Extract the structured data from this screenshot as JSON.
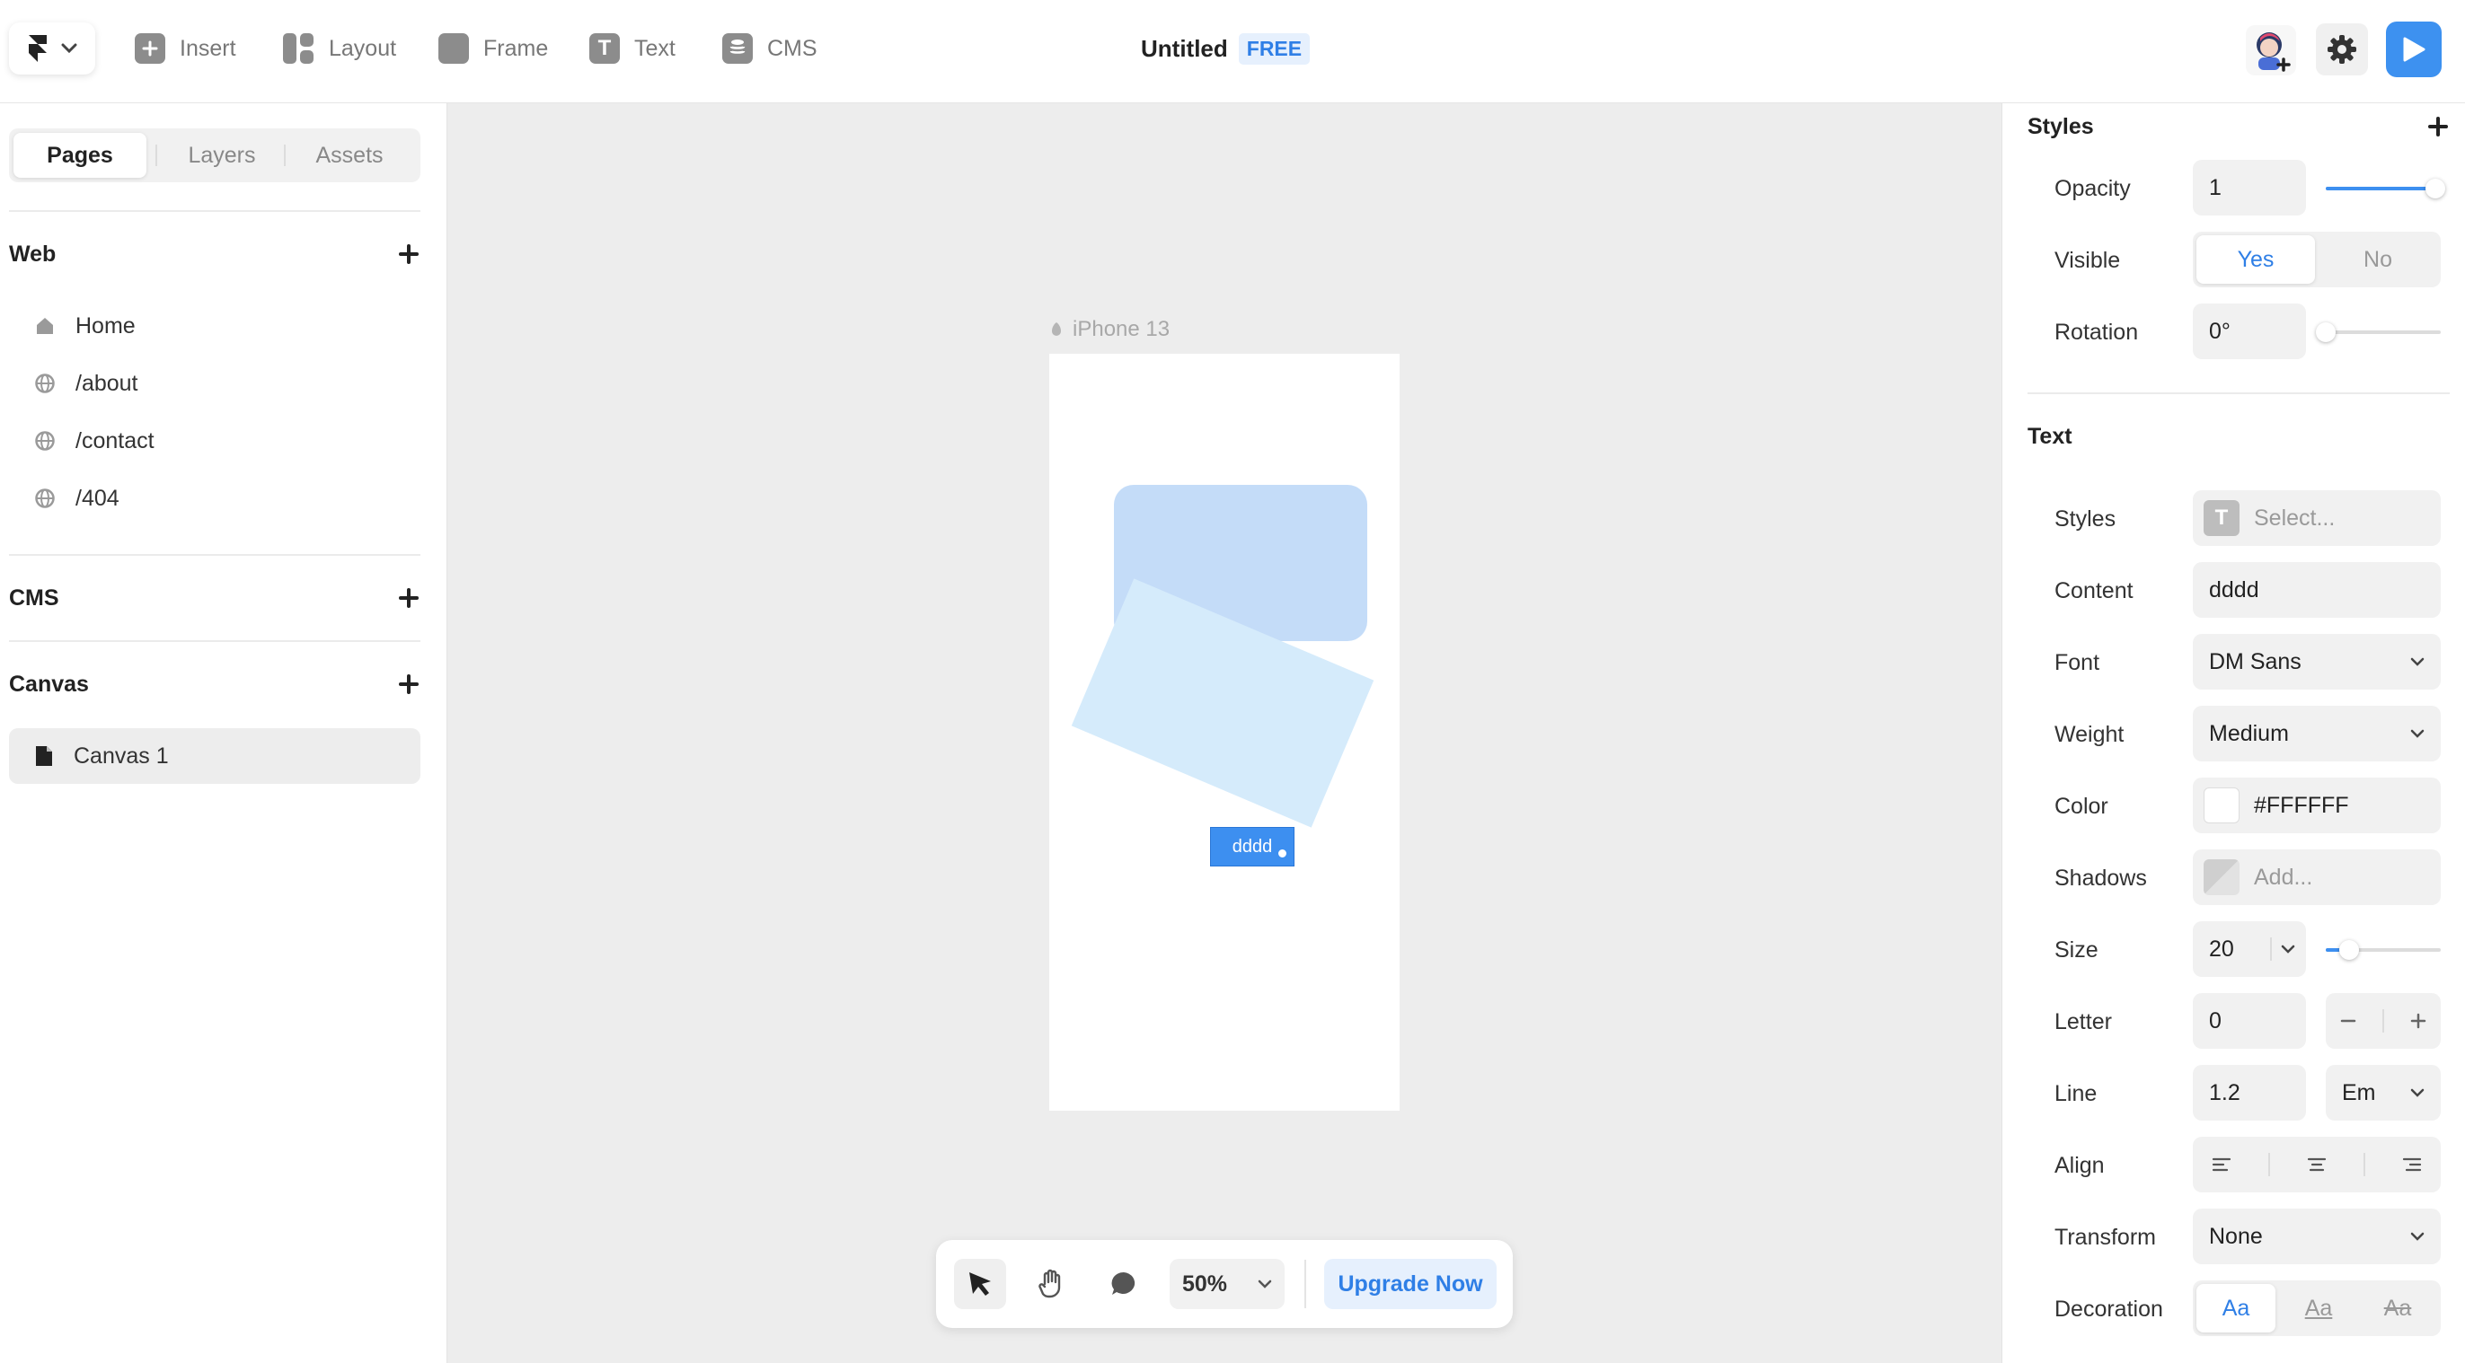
{
  "topbar": {
    "tools": [
      {
        "label": "Insert",
        "icon": "plus-square-icon"
      },
      {
        "label": "Layout",
        "icon": "layout-icon"
      },
      {
        "label": "Frame",
        "icon": "frame-icon"
      },
      {
        "label": "Text",
        "icon": "text-icon"
      },
      {
        "label": "CMS",
        "icon": "database-icon"
      }
    ],
    "text_tool_glyph": "T",
    "doc_title": "Untitled",
    "plan_badge": "FREE"
  },
  "sidebar": {
    "tabs": [
      "Pages",
      "Layers",
      "Assets"
    ],
    "active_tab": "Pages",
    "web_title": "Web",
    "pages": [
      {
        "label": "Home",
        "icon": "home-icon"
      },
      {
        "label": "/about",
        "icon": "globe-icon"
      },
      {
        "label": "/contact",
        "icon": "globe-icon"
      },
      {
        "label": "/404",
        "icon": "globe-icon"
      }
    ],
    "cms_title": "CMS",
    "canvas_title": "Canvas",
    "canvases": [
      {
        "label": "Canvas 1",
        "icon": "file-icon"
      }
    ]
  },
  "canvas": {
    "frame_label": "iPhone 13",
    "selected_text": "dddd"
  },
  "bottombar": {
    "zoom": "50%",
    "upgrade_label": "Upgrade Now"
  },
  "properties": {
    "styles_title": "Styles",
    "opacity_label": "Opacity",
    "opacity_value": "1",
    "opacity_fraction": 0.95,
    "visible_label": "Visible",
    "visible_yes": "Yes",
    "visible_no": "No",
    "visible_selected": "Yes",
    "rotation_label": "Rotation",
    "rotation_value": "0°",
    "rotation_fraction": 0.0,
    "text_title": "Text",
    "text_styles_label": "Styles",
    "text_styles_placeholder": "Select...",
    "text_styles_glyph": "T",
    "content_label": "Content",
    "content_value": "dddd",
    "font_label": "Font",
    "font_value": "DM Sans",
    "weight_label": "Weight",
    "weight_value": "Medium",
    "color_label": "Color",
    "color_value": "#FFFFFF",
    "shadows_label": "Shadows",
    "shadows_placeholder": "Add...",
    "size_label": "Size",
    "size_value": "20",
    "size_fraction": 0.2,
    "letter_label": "Letter",
    "letter_value": "0",
    "line_label": "Line",
    "line_value": "1.2",
    "line_unit": "Em",
    "align_label": "Align",
    "transform_label": "Transform",
    "transform_value": "None",
    "decoration_label": "Decoration",
    "decoration_options": [
      "Aa",
      "Aa",
      "Aa"
    ]
  },
  "colors": {
    "accent": "#3d8ff0",
    "rect_blue": "#c4dcf8",
    "rect_light": "#d5ebfb",
    "canvas_bg": "#ededed"
  }
}
